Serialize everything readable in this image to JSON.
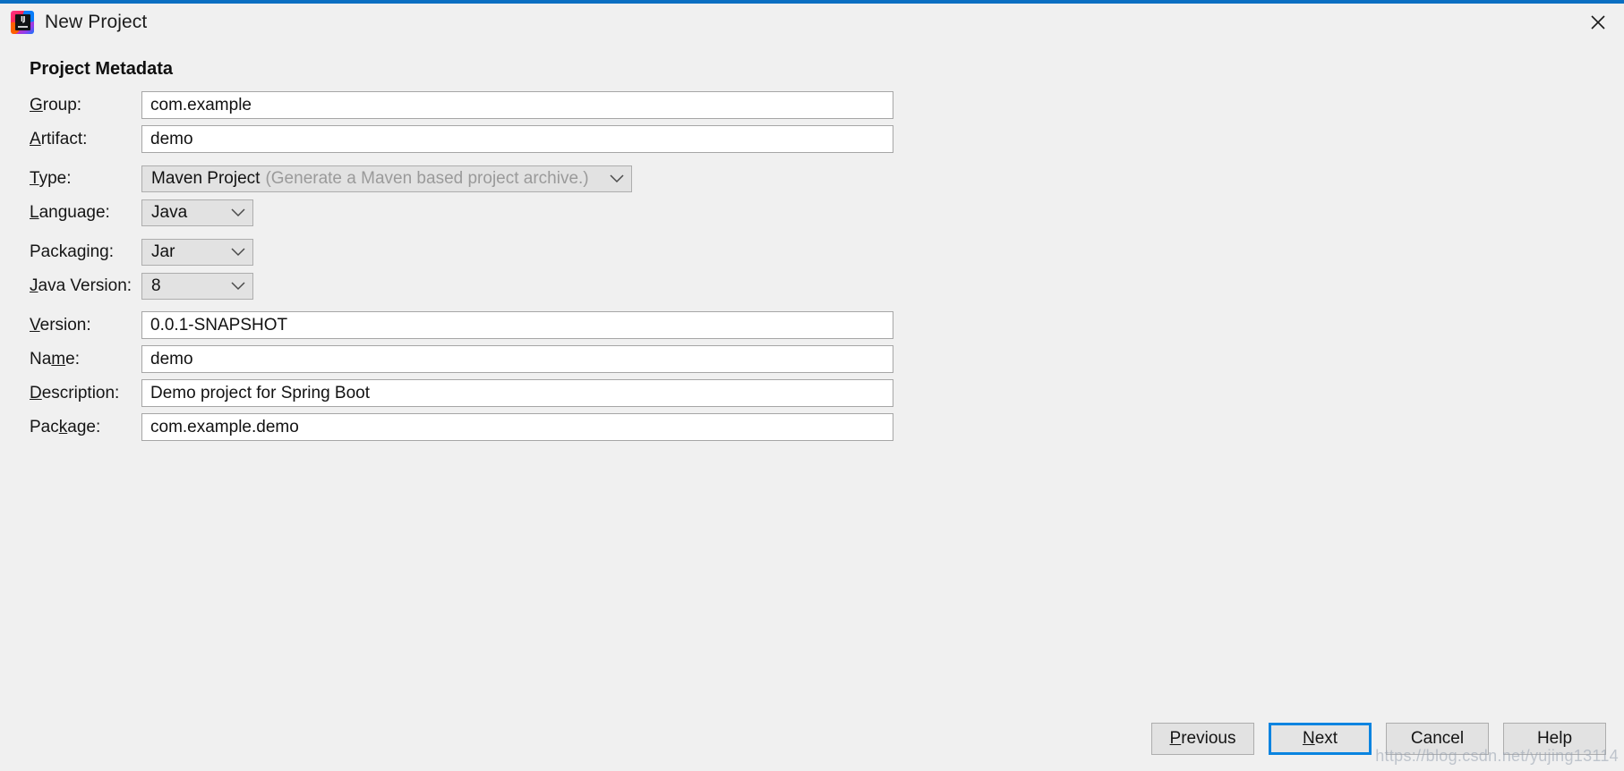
{
  "window": {
    "title": "New Project",
    "icon": "intellij-idea-icon",
    "close_label": "×",
    "accent_color": "#0a6fc2"
  },
  "section": {
    "title": "Project Metadata"
  },
  "fields": {
    "group": {
      "label_pre": "",
      "label_mn": "G",
      "label_post": "roup:",
      "value": "com.example"
    },
    "artifact": {
      "label_pre": "",
      "label_mn": "A",
      "label_post": "rtifact:",
      "value": "demo"
    },
    "type": {
      "label_pre": "",
      "label_mn": "T",
      "label_post": "ype:",
      "value": "Maven Project",
      "hint": "(Generate a Maven based project archive.)"
    },
    "language": {
      "label_pre": "",
      "label_mn": "L",
      "label_post": "anguage:",
      "value": "Java"
    },
    "packaging": {
      "label_pre": "Packa",
      "label_mn": "g",
      "label_post": "ing:",
      "value": "Jar"
    },
    "javaversion": {
      "label_pre": "",
      "label_mn": "J",
      "label_post": "ava Version:",
      "value": "8"
    },
    "version": {
      "label_pre": "",
      "label_mn": "V",
      "label_post": "ersion:",
      "value": "0.0.1-SNAPSHOT"
    },
    "name": {
      "label_pre": "Na",
      "label_mn": "m",
      "label_post": "e:",
      "value": "demo"
    },
    "description": {
      "label_pre": "",
      "label_mn": "D",
      "label_post": "escription:",
      "value": "Demo project for Spring Boot"
    },
    "package": {
      "label_pre": "Pac",
      "label_mn": "k",
      "label_post": "age:",
      "value": "com.example.demo"
    }
  },
  "buttons": {
    "previous": {
      "pre": "",
      "mn": "P",
      "post": "revious"
    },
    "next": {
      "pre": "",
      "mn": "N",
      "post": "ext"
    },
    "cancel": {
      "pre": "Cancel",
      "mn": "",
      "post": ""
    },
    "help": {
      "pre": "Help",
      "mn": "",
      "post": ""
    }
  },
  "watermark": "https://blog.csdn.net/yujing13114"
}
